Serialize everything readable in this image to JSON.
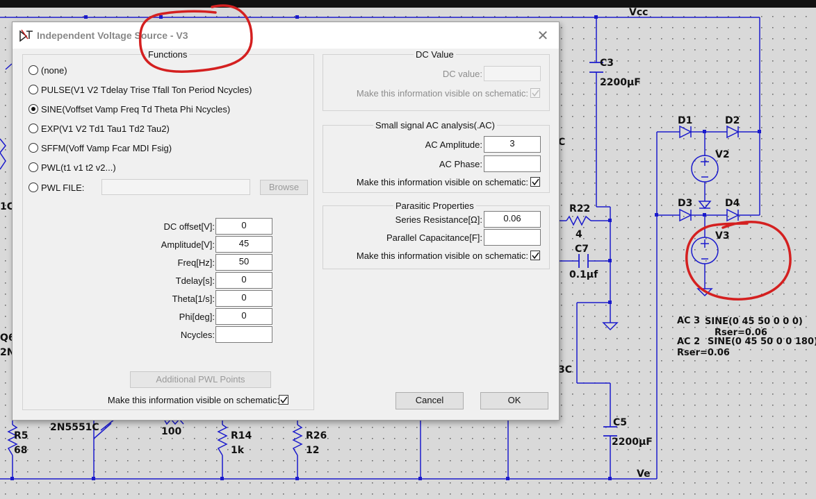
{
  "dialog": {
    "title": "Independent Voltage Source - V3",
    "functions_legend": "Functions",
    "functions": [
      {
        "label": "(none)",
        "selected": false
      },
      {
        "label": "PULSE(V1 V2 Tdelay Trise Tfall Ton Period Ncycles)",
        "selected": false
      },
      {
        "label": "SINE(Voffset Vamp Freq Td Theta Phi Ncycles)",
        "selected": true
      },
      {
        "label": "EXP(V1 V2 Td1 Tau1 Td2 Tau2)",
        "selected": false
      },
      {
        "label": "SFFM(Voff Vamp Fcar MDI Fsig)",
        "selected": false
      },
      {
        "label": "PWL(t1 v1 t2 v2...)",
        "selected": false
      },
      {
        "label": "PWL FILE:",
        "selected": false
      }
    ],
    "pwl_file_value": "",
    "browse_label": "Browse",
    "sine_params": [
      {
        "label": "DC offset[V]:",
        "value": "0"
      },
      {
        "label": "Amplitude[V]:",
        "value": "45"
      },
      {
        "label": "Freq[Hz]:",
        "value": "50"
      },
      {
        "label": "Tdelay[s]:",
        "value": "0"
      },
      {
        "label": "Theta[1/s]:",
        "value": "0"
      },
      {
        "label": "Phi[deg]:",
        "value": "0"
      },
      {
        "label": "Ncycles:",
        "value": ""
      }
    ],
    "additional_pwl_label": "Additional PWL Points",
    "make_visible_label": "Make this information visible on schematic:",
    "dc_value": {
      "legend": "DC Value",
      "label": "DC value:",
      "value": ""
    },
    "ac": {
      "legend": "Small signal AC analysis(.AC)",
      "amplitude_label": "AC Amplitude:",
      "amplitude_value": "3",
      "phase_label": "AC Phase:",
      "phase_value": ""
    },
    "parasitic": {
      "legend": "Parasitic Properties",
      "series_label": "Series Resistance[Ω]:",
      "series_value": "0.06",
      "parallel_label": "Parallel Capacitance[F]:",
      "parallel_value": ""
    },
    "cancel_label": "Cancel",
    "ok_label": "OK"
  },
  "schematic": {
    "net_vcc": "Vcc",
    "net_ve": "Ve",
    "c3": {
      "name": "C3",
      "value": "2200µF"
    },
    "c5": {
      "name": "C5",
      "value": "2200µF"
    },
    "c7": {
      "name": "C7",
      "value": "0.1µf"
    },
    "r22": {
      "name": "R22",
      "value": "4"
    },
    "r5": {
      "name": "R5",
      "value": "68"
    },
    "r14": {
      "name": "R14",
      "value": "1k"
    },
    "r26": {
      "name": "R26",
      "value": "12"
    },
    "r_mid_value": "100",
    "q_label": "2N5551C",
    "d1": "D1",
    "d2": "D2",
    "d3": "D3",
    "d4": "D4",
    "v2": "V2",
    "v3": "V3",
    "v3_ac": "AC 3",
    "v3_sine": "SINE(0 45 50 0 0 0)",
    "v3_rser": "Rser=0.06",
    "v2_ac": "AC 2",
    "v2_sine": "SINE(0 45 50 0 0 180)",
    "v2_rser": "Rser=0.06",
    "frag_1c": "1C",
    "frag_q6": "Q6",
    "frag_2n": "2N",
    "frag_3c": "3C",
    "frag_c": "C"
  },
  "colors": {
    "wire": "#1a1acc",
    "annotation": "#d42020",
    "background": "#d9d9d9"
  }
}
